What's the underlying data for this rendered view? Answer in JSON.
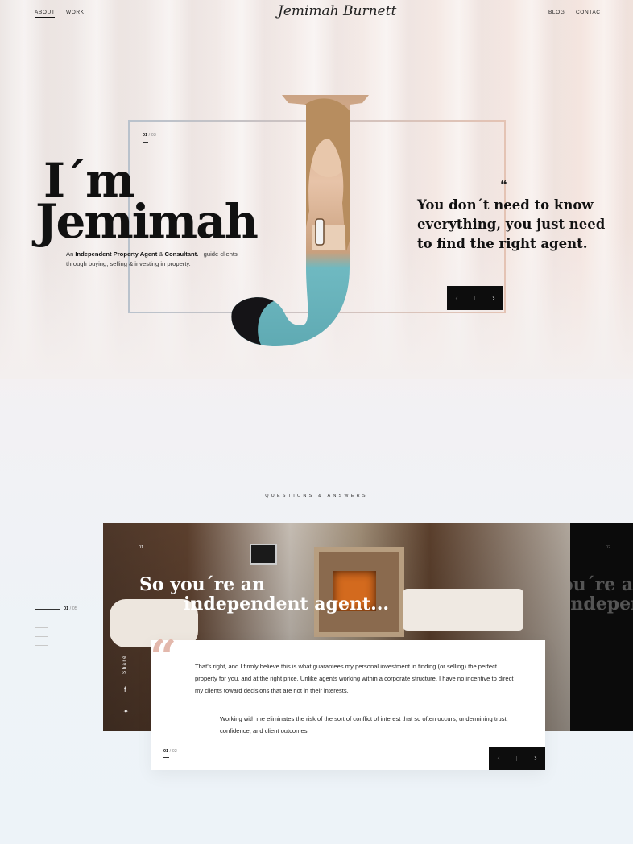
{
  "nav": {
    "about": "About",
    "work": "Work",
    "logo": "Jemimah Burnett",
    "blog": "Blog",
    "contact": "Contact"
  },
  "hero": {
    "counter_current": "01",
    "counter_total": "/ 03",
    "title_line1": "I´m",
    "title_line2": "Jemimah",
    "intro_pre": "An ",
    "intro_bold1": "Independent Property Agent",
    "intro_mid": " & ",
    "intro_bold2": "Consultant.",
    "intro_post": " I guide clients through buying, selling & investing in property.",
    "letter": "J",
    "quote_mark": "❝",
    "quote": "You don´t need to know everything, you just need to find the right agent.",
    "prev_icon": "chevron-left-icon",
    "next_icon": "chevron-right-icon"
  },
  "qa": {
    "section_label": "Questions & Answers",
    "side_counter_current": "01",
    "side_counter_total": "/ 05",
    "slide_counter": "01",
    "next_slide_counter": "02",
    "title_line1": "So you´re an",
    "title_line2": "independent agent...",
    "next_title_line1": "So you´re an",
    "next_title_line2": "indepen",
    "share_label": "Share",
    "answer_p1": "That's right, and I firmly believe this is what guarantees my personal investment in finding (or selling) the perfect property for you, and at the right price. Unlike agents working within a corporate structure, I have no incentive to direct my clients toward decisions that are not in their interests.",
    "answer_p2": "Working with me eliminates the risk of the sort of conflict of interest that so often occurs, undermining trust, confidence, and client outcomes.",
    "card_counter_current": "01",
    "card_counter_total": "/ 02"
  },
  "colors": {
    "accent_teal": "#6fb9c1",
    "quote_pink": "#e3b8ac",
    "dark": "#0d0d0d"
  }
}
